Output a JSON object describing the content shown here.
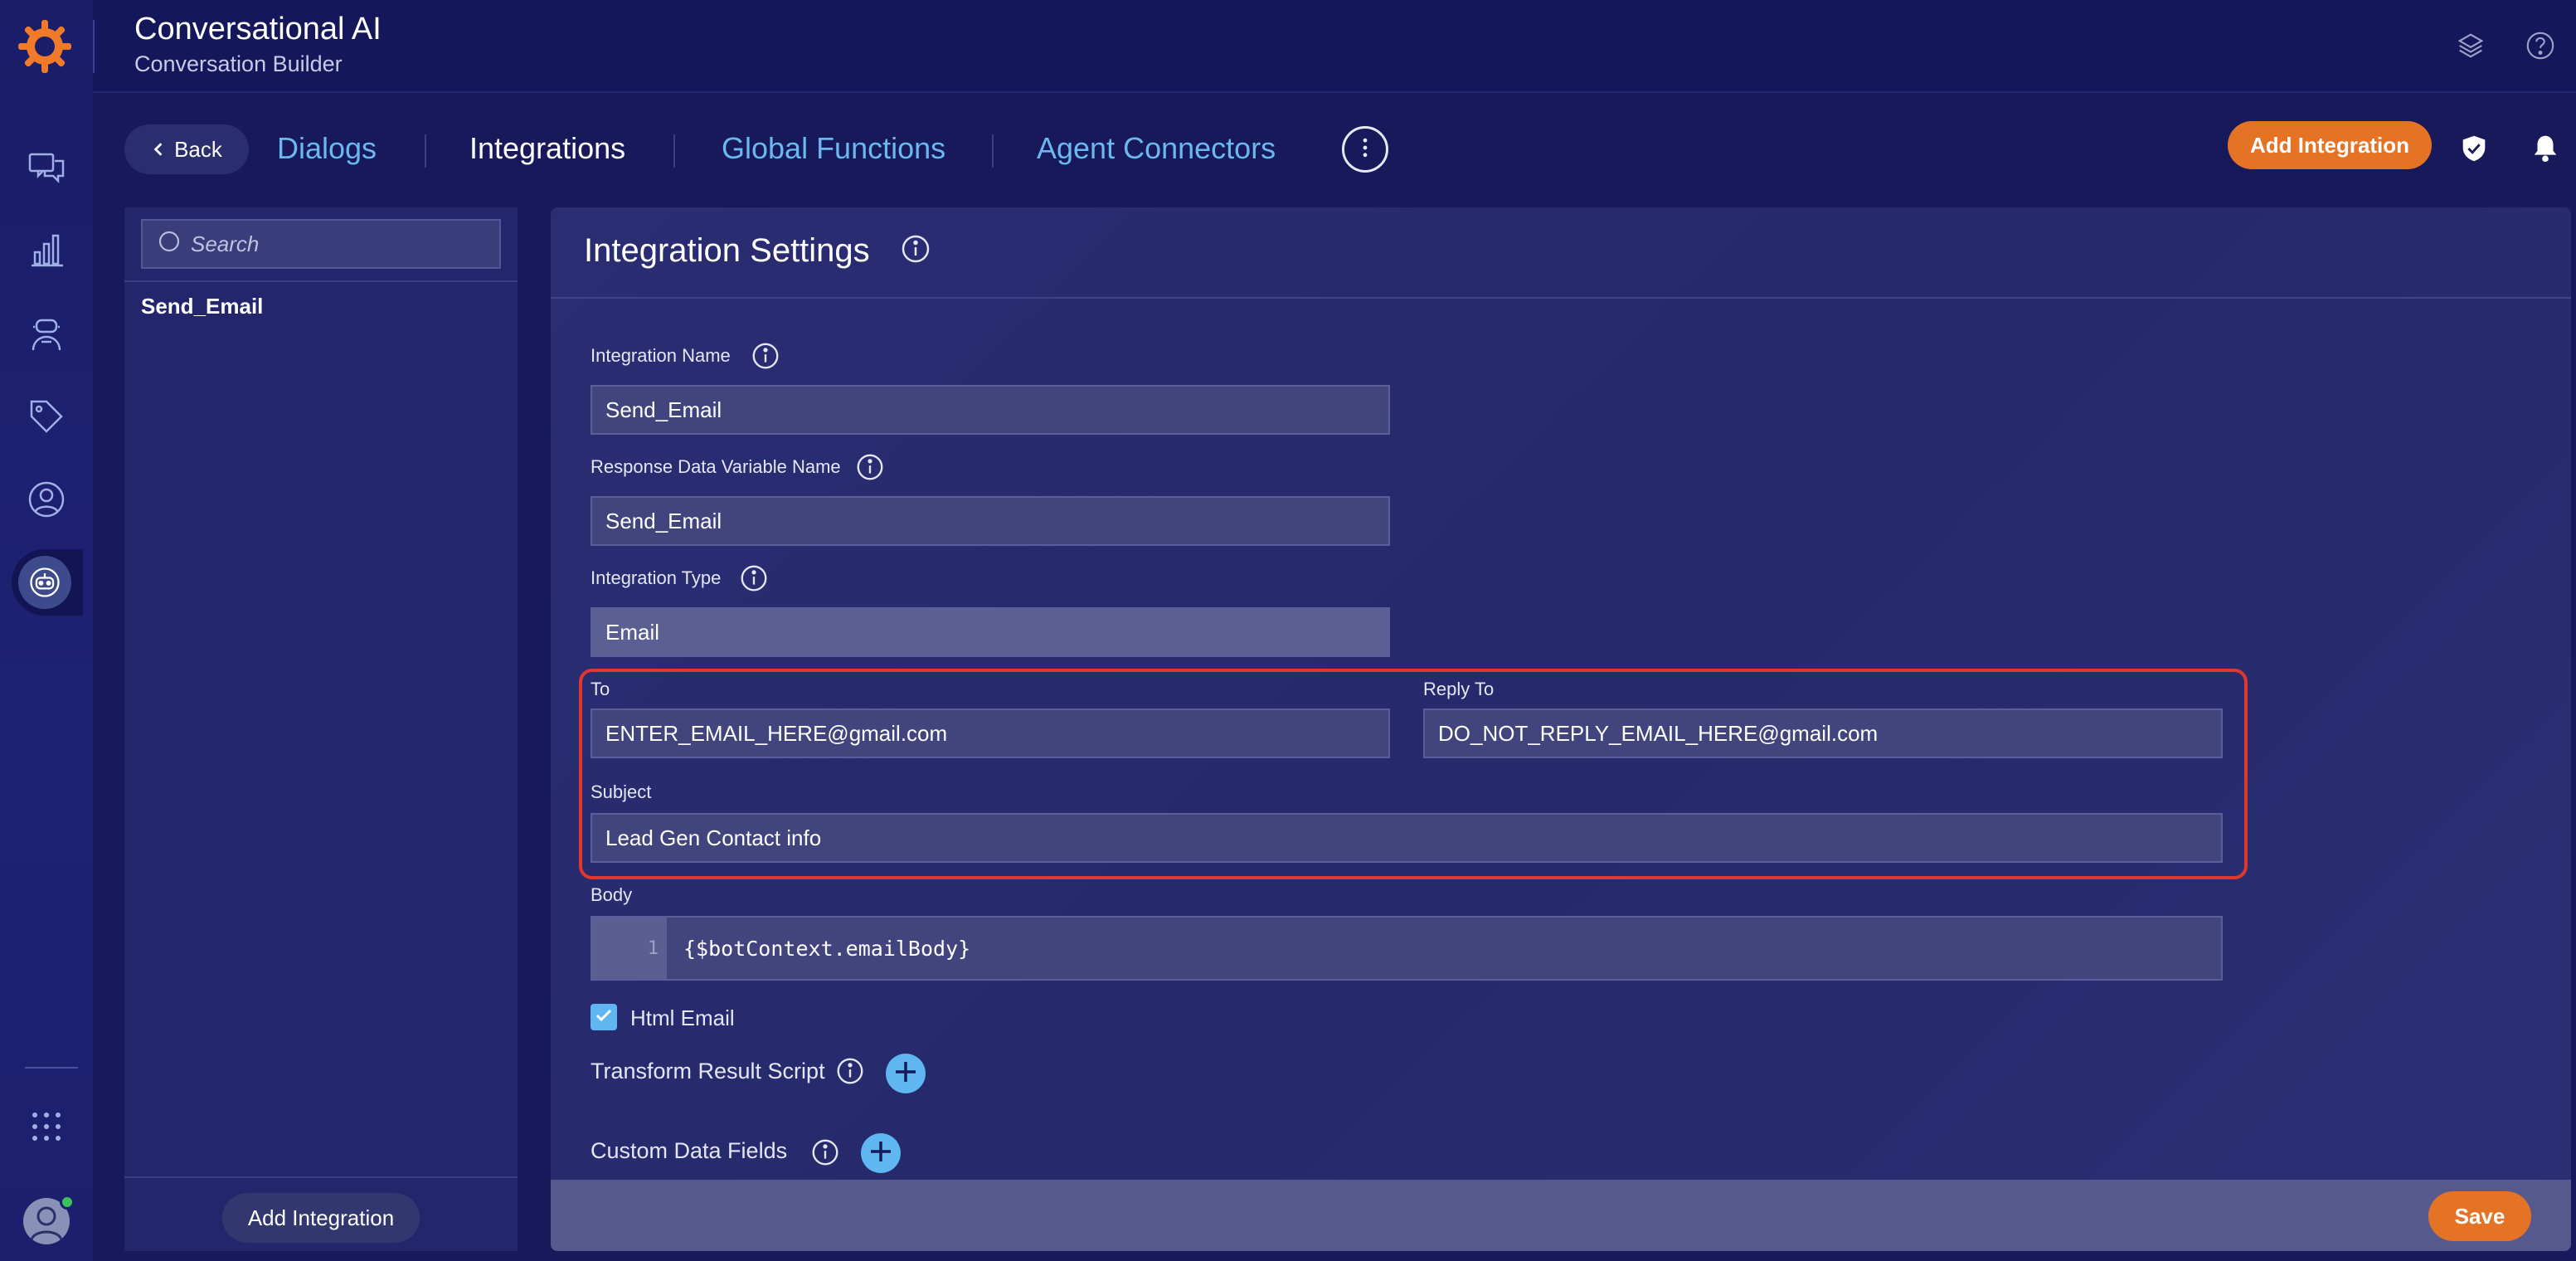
{
  "header": {
    "app_title": "Conversational AI",
    "app_subtitle": "Conversation Builder"
  },
  "rail": {
    "icons": [
      "chat-icon",
      "analytics-icon",
      "agent-icon",
      "tag-icon",
      "user-profile-icon",
      "bot-icon",
      "apps-grid-icon"
    ],
    "active": "bot-icon"
  },
  "nav": {
    "back_label": "Back",
    "tabs": [
      {
        "label": "Dialogs",
        "active": false
      },
      {
        "label": "Integrations",
        "active": true
      },
      {
        "label": "Global Functions",
        "active": false
      },
      {
        "label": "Agent Connectors",
        "active": false
      }
    ],
    "add_integration_label": "Add Integration"
  },
  "left_panel": {
    "search_placeholder": "Search",
    "items": [
      "Send_Email"
    ],
    "add_integration_label": "Add Integration"
  },
  "form": {
    "title": "Integration Settings",
    "integration_name_label": "Integration Name",
    "integration_name_value": "Send_Email",
    "response_var_label": "Response Data Variable Name",
    "response_var_value": "Send_Email",
    "integration_type_label": "Integration Type",
    "integration_type_value": "Email",
    "to_label": "To",
    "to_value": "ENTER_EMAIL_HERE@gmail.com",
    "reply_to_label": "Reply To",
    "reply_to_value": "DO_NOT_REPLY_EMAIL_HERE@gmail.com",
    "subject_label": "Subject",
    "subject_value": "Lead Gen Contact info",
    "body_label": "Body",
    "body_line_number": "1",
    "body_code": "{$botContext.emailBody}",
    "html_email_label": "Html Email",
    "html_email_checked": true,
    "transform_label": "Transform Result Script",
    "custom_fields_label": "Custom Data Fields",
    "save_label": "Save"
  },
  "colors": {
    "accent_orange": "#e57326",
    "accent_blue": "#5fb6f0",
    "highlight_red": "#e1372c"
  }
}
